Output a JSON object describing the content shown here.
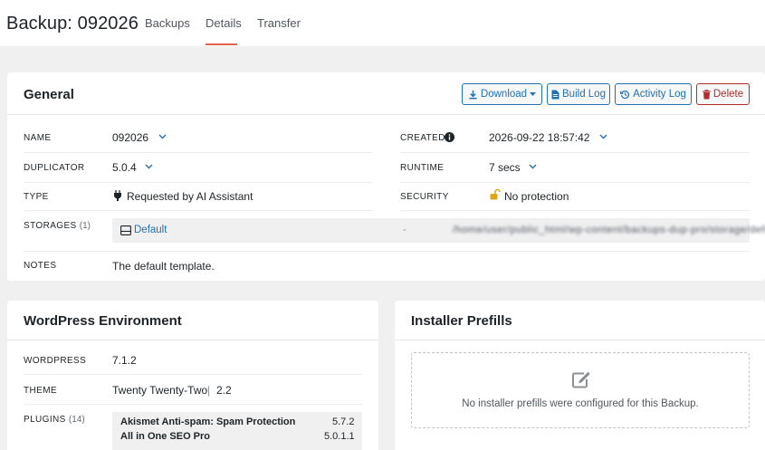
{
  "header": {
    "title": "Backup: 092026",
    "tabs": [
      {
        "label": "Backups"
      },
      {
        "label": "Details"
      },
      {
        "label": "Transfer"
      }
    ]
  },
  "general": {
    "title": "General",
    "buttons": {
      "download": "Download",
      "build_log": "Build Log",
      "activity_log": "Activity Log",
      "delete": "Delete"
    },
    "fields": {
      "name_label": "NAME",
      "name_value": "092026",
      "duplicator_label": "DUPLICATOR",
      "duplicator_value": "5.0.4",
      "type_label": "TYPE",
      "type_value": "Requested by AI Assistant",
      "created_label": "CREATED",
      "created_value": "2026-09-22 18:57:42",
      "runtime_label": "RUNTIME",
      "runtime_value": "7 secs",
      "security_label": "SECURITY",
      "security_value": "No protection",
      "storages_label": "STORAGES",
      "storages_count": "(1)",
      "storage_name": "Default",
      "storage_path": "-",
      "notes_label": "NOTES",
      "notes_value": "The default template."
    }
  },
  "wp_env": {
    "title": "WordPress Environment",
    "wordpress_label": "WORDPRESS",
    "wordpress_value": "7.1.2",
    "theme_label": "THEME",
    "theme_name": "Twenty Twenty-Two",
    "theme_sep": "|",
    "theme_version": "2.2",
    "plugins_label": "PLUGINS",
    "plugins_count": "(14)",
    "plugins": [
      {
        "name": "Akismet Anti-spam: Spam Protection",
        "version": "5.7.2"
      },
      {
        "name": "All in One SEO Pro",
        "version": "5.0.1.1"
      }
    ]
  },
  "installer": {
    "title": "Installer Prefills",
    "empty_text": "No installer prefills were configured for this Backup."
  },
  "colors": {
    "accent": "#2271b1",
    "danger": "#b32d2e",
    "tab_underline": "#e8604c",
    "lock": "#dba617"
  }
}
